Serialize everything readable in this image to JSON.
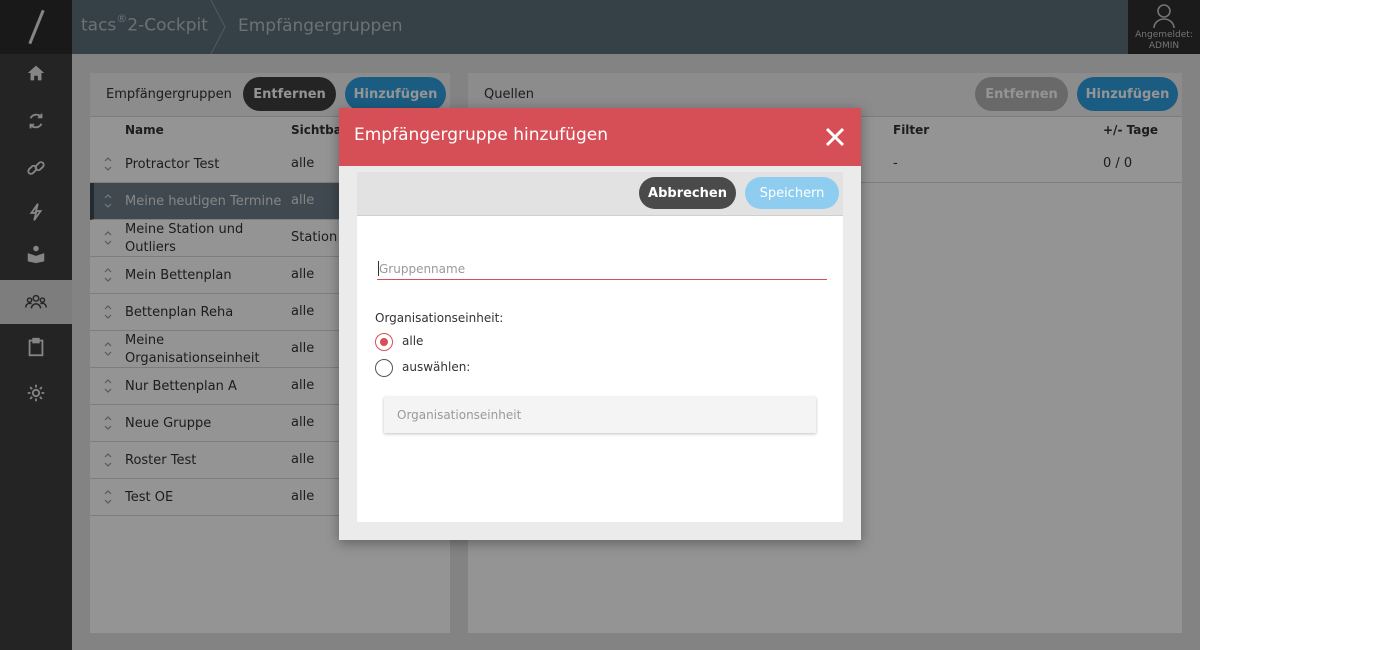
{
  "app": {
    "brand_prefix": "tacs",
    "brand_sup": "®",
    "brand_suffix": "2-Cockpit",
    "page_title": "Empfängergruppen"
  },
  "user": {
    "label": "Angemeldet:",
    "name": "ADMIN"
  },
  "sidebar": {
    "items": [
      {
        "icon": "home-icon"
      },
      {
        "icon": "sync-icon"
      },
      {
        "icon": "link-icon"
      },
      {
        "icon": "lightning-icon"
      },
      {
        "icon": "book-reader-icon"
      },
      {
        "icon": "users-group-icon",
        "active": true
      },
      {
        "icon": "clipboard-icon"
      },
      {
        "icon": "gear-icon"
      }
    ]
  },
  "left_panel": {
    "title": "Empfängergruppen",
    "remove_label": "Entfernen",
    "add_label": "Hinzufügen",
    "columns": [
      "Name",
      "Sichtbar"
    ],
    "rows": [
      {
        "name": "Protractor Test",
        "visibility": "alle"
      },
      {
        "name": "Meine heutigen Termine",
        "visibility": "alle",
        "selected": true
      },
      {
        "name": "Meine Station und Outliers",
        "visibility": "Station A"
      },
      {
        "name": "Mein Bettenplan",
        "visibility": "alle"
      },
      {
        "name": "Bettenplan Reha",
        "visibility": "alle"
      },
      {
        "name": "Meine Organisationseinheit",
        "visibility": "alle"
      },
      {
        "name": "Nur Bettenplan A",
        "visibility": "alle"
      },
      {
        "name": "Neue Gruppe",
        "visibility": "alle"
      },
      {
        "name": "Roster Test",
        "visibility": "alle"
      },
      {
        "name": "Test OE",
        "visibility": "alle"
      }
    ]
  },
  "right_panel": {
    "title": "Quellen",
    "remove_label": "Entfernen",
    "add_label": "Hinzufügen",
    "columns": [
      "Filter",
      "+/- Tage"
    ],
    "rows": [
      {
        "filter": "-",
        "days": "0 / 0"
      }
    ]
  },
  "modal": {
    "title": "Empfängergruppe hinzufügen",
    "cancel_label": "Abbrechen",
    "save_label": "Speichern",
    "group_name_placeholder": "Gruppenname",
    "group_name_value": "",
    "org_label": "Organisationseinheit:",
    "radio_all_label": "alle",
    "radio_select_label": "auswählen:",
    "radio_selected": "alle",
    "org_select_placeholder": "Organisationseinheit"
  },
  "colors": {
    "accent_red": "#d64f57",
    "accent_blue": "#2f9fe0",
    "topbar": "#5e6f7b",
    "sidebar": "#3f3f3f"
  }
}
